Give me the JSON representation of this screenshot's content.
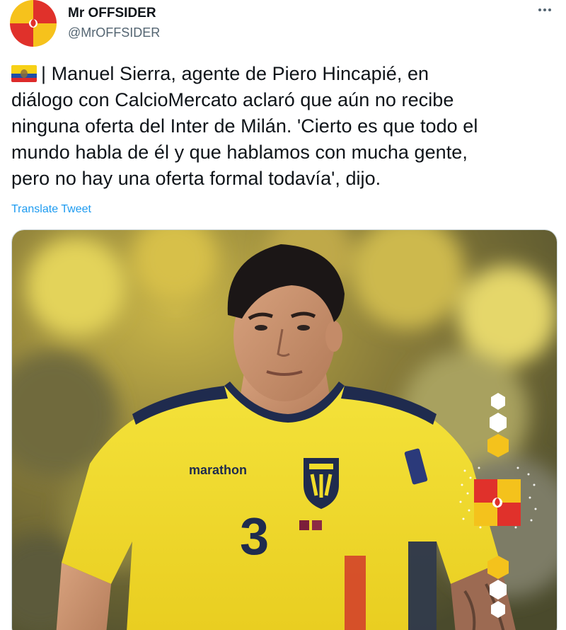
{
  "author": {
    "display_name": "Mr OFFSIDER",
    "handle": "@MrOFFSIDER",
    "avatar_icon": "mr-offsider-logo-icon"
  },
  "more_icon": "more-dots-icon",
  "tweet": {
    "flag_icon": "ecuador-flag-icon",
    "lines": [
      "| Manuel Sierra, agente de Piero Hincapié, en",
      "diálogo con CalcioMercato aclaró que aún no recibe",
      "ninguna oferta del Inter de Milán. 'Cierto es que todo el",
      "mundo habla de él y que hablamos con mucha gente,",
      "pero no hay una oferta formal todavía', dijo."
    ]
  },
  "translate_label": "Translate Tweet",
  "media": {
    "jersey": {
      "sponsor": "marathon",
      "number": "3"
    },
    "watermark_icon": "mr-offsider-watermark-icon"
  },
  "colors": {
    "link": "#1d9bf0",
    "brand_red": "#e0312b",
    "brand_yellow": "#f6c21c",
    "jersey_yellow": "#f2dd2a",
    "jersey_navy": "#1f2b4e"
  }
}
